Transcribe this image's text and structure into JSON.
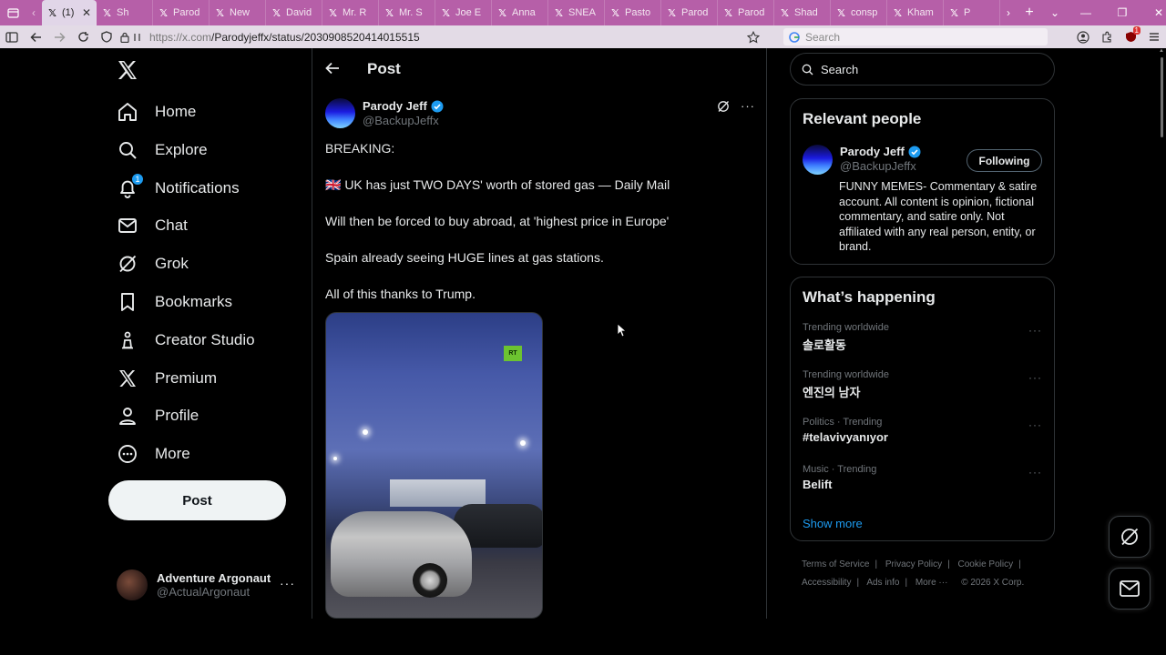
{
  "browser": {
    "tabs": [
      {
        "label": "(1)",
        "active": true
      },
      {
        "label": "Sh"
      },
      {
        "label": "Parod"
      },
      {
        "label": "New"
      },
      {
        "label": "David"
      },
      {
        "label": "Mr. R"
      },
      {
        "label": "Mr. S"
      },
      {
        "label": "Joe E"
      },
      {
        "label": "Anna"
      },
      {
        "label": "SNEA"
      },
      {
        "label": "Pasto"
      },
      {
        "label": "Parod"
      },
      {
        "label": "Parod"
      },
      {
        "label": "Shad"
      },
      {
        "label": "consp"
      },
      {
        "label": "Kham"
      },
      {
        "label": "P"
      }
    ],
    "url_host": "https://x.com",
    "url_path": "/Parodyjeffx/status/2030908520414015515",
    "search_placeholder": "Search",
    "extension_count": "1"
  },
  "nav": {
    "items": [
      {
        "label": "Home",
        "icon": "home-icon"
      },
      {
        "label": "Explore",
        "icon": "search-icon"
      },
      {
        "label": "Notifications",
        "icon": "bell-icon",
        "badge": "1"
      },
      {
        "label": "Chat",
        "icon": "mail-icon"
      },
      {
        "label": "Grok",
        "icon": "grok-icon"
      },
      {
        "label": "Bookmarks",
        "icon": "bookmark-icon"
      },
      {
        "label": "Creator Studio",
        "icon": "creator-icon"
      },
      {
        "label": "Premium",
        "icon": "x-logo-icon"
      },
      {
        "label": "Profile",
        "icon": "person-icon"
      },
      {
        "label": "More",
        "icon": "more-circle-icon"
      }
    ],
    "post_button": "Post",
    "account": {
      "name": "Adventure Argonaut",
      "handle": "@ActualArgonaut"
    }
  },
  "post": {
    "header_title": "Post",
    "author_name": "Parody Jeff",
    "author_handle": "@BackupJeffx",
    "lines": [
      "BREAKING:",
      "🇬🇧 UK has just TWO DAYS' worth of stored gas — Daily Mail",
      "Will then be forced to buy abroad, at 'highest price in Europe'",
      "Spain already seeing HUGE lines at gas stations.",
      "All of this thanks to Trump."
    ],
    "media_logo": "RT"
  },
  "sidebar": {
    "search_placeholder": "Search",
    "relevant": {
      "title": "Relevant people",
      "name": "Parody Jeff",
      "handle": "@BackupJeffx",
      "follow_label": "Following",
      "bio": "FUNNY MEMES- Commentary & satire account. All content is opinion, fictional commentary, and satire only. Not affiliated with any real person, entity, or brand."
    },
    "happening": {
      "title": "What’s happening",
      "trends": [
        {
          "meta": "Trending worldwide",
          "topic": "솔로활동"
        },
        {
          "meta": "Trending worldwide",
          "topic": "엔진의 남자"
        },
        {
          "meta": "Politics · Trending",
          "topic": "#telavivyanıyor"
        },
        {
          "meta": "Music · Trending",
          "topic": "Belift"
        }
      ],
      "show_more": "Show more"
    },
    "footer": [
      "Terms of Service",
      "Privacy Policy",
      "Cookie Policy",
      "Accessibility",
      "Ads info",
      "More ···",
      "© 2026 X Corp."
    ]
  },
  "colors": {
    "accent": "#1d9bf0",
    "tabbar": "#b65fa8",
    "background": "#000000"
  }
}
